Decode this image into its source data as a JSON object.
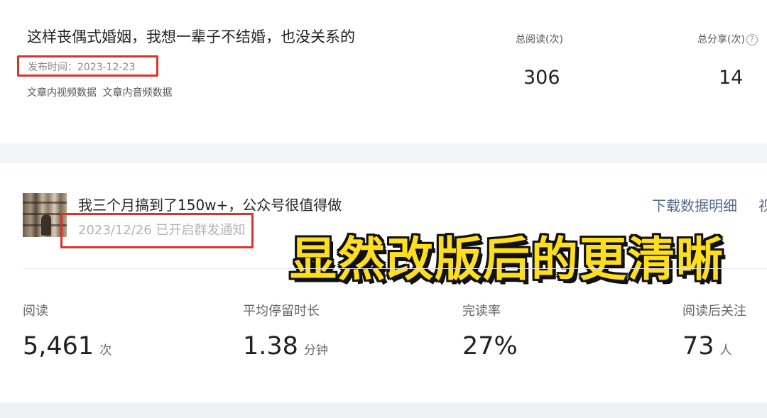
{
  "top_article": {
    "title": "这样丧偶式婚姻，我想一辈子不结婚，也没关系的",
    "publish_time": "发布时间：2023-12-23",
    "links": [
      "文章内视频数据",
      "文章内音频数据"
    ],
    "stats": {
      "reads_label": "总阅读(次)",
      "reads_value": "306",
      "shares_label": "总分享(次)",
      "shares_value": "14",
      "help_icon": "?"
    }
  },
  "article_card": {
    "title": "我三个月搞到了150w+，公众号很值得做",
    "date_text": "2023/12/26 已开启群发通知",
    "download_link": "下载数据明细",
    "cut_link": "视",
    "overlay_caption": "显然改版后的更清晰",
    "metrics": [
      {
        "label": "阅读",
        "value": "5,461",
        "unit": "次"
      },
      {
        "label": "平均停留时长",
        "value": "1.38",
        "unit": "分钟"
      },
      {
        "label": "完读率",
        "value": "27%",
        "unit": ""
      },
      {
        "label": "阅读后关注",
        "value": "73",
        "unit": "人"
      }
    ]
  },
  "colors": {
    "highlight_box": "#d9332b",
    "overlay_text": "#ffde1f",
    "link": "#556a8a"
  }
}
